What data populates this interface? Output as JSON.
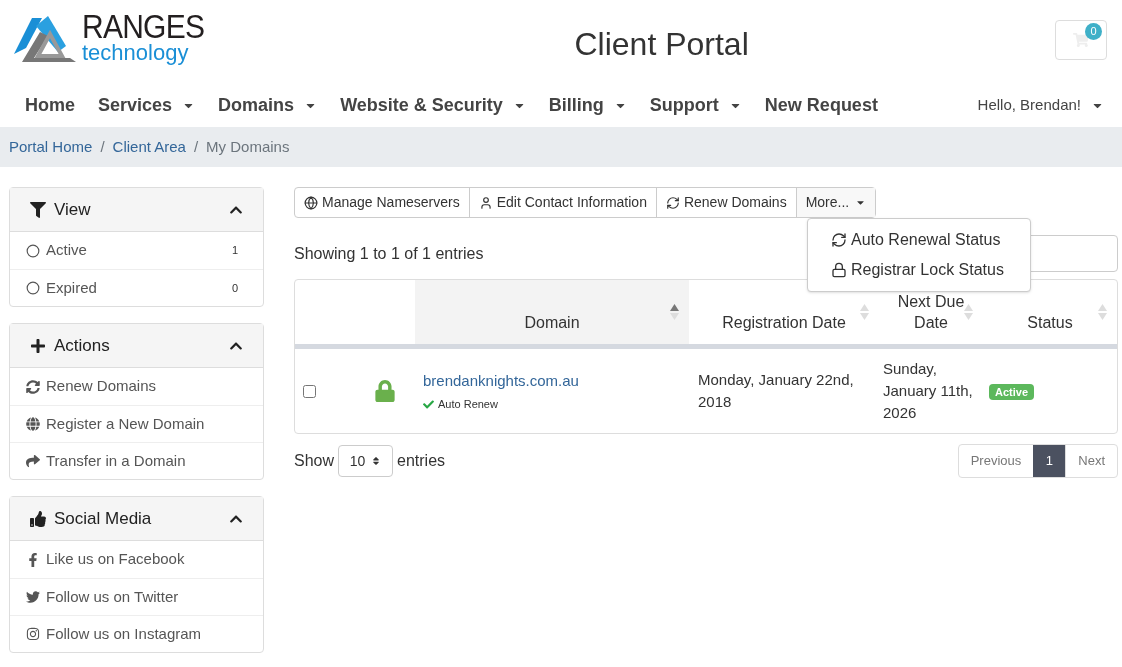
{
  "header": {
    "logo": {
      "line_1": "RANGES",
      "line_2": "technology"
    },
    "title": "Client Portal",
    "cart": {
      "count": "0"
    }
  },
  "nav": {
    "items": [
      {
        "label": "Home",
        "dropdown": false
      },
      {
        "label": "Services",
        "dropdown": true
      },
      {
        "label": "Domains",
        "dropdown": true
      },
      {
        "label": "Website & Security",
        "dropdown": true
      },
      {
        "label": "Billing",
        "dropdown": true
      },
      {
        "label": "Support",
        "dropdown": true
      },
      {
        "label": "New Request",
        "dropdown": false
      }
    ],
    "user": "Hello, Brendan!"
  },
  "breadcrumb": {
    "separator": "/",
    "items": [
      {
        "label": "Portal Home",
        "link": true
      },
      {
        "label": "Client Area",
        "link": true
      },
      {
        "label": "My Domains",
        "link": false
      }
    ]
  },
  "sidebar": [
    {
      "title": "View",
      "expanded": true,
      "items": [
        {
          "label": "Active",
          "count": "1"
        },
        {
          "label": "Expired",
          "count": "0"
        }
      ]
    },
    {
      "title": "Actions",
      "expanded": true,
      "items": [
        {
          "label": "Renew Domains"
        },
        {
          "label": "Register a New Domain"
        },
        {
          "label": "Transfer in a Domain"
        }
      ]
    },
    {
      "title": "Social Media",
      "expanded": true,
      "items": [
        {
          "label": "Like us on Facebook"
        },
        {
          "label": "Follow us on Twitter"
        },
        {
          "label": "Follow us on Instagram"
        }
      ]
    }
  ],
  "toolbar": {
    "buttons": [
      "Manage Nameservers",
      "Edit Contact Information",
      "Renew Domains"
    ],
    "more": {
      "label": "More...",
      "expanded": true,
      "items": [
        "Auto Renewal Status",
        "Registrar Lock Status"
      ]
    }
  },
  "info": "Showing 1 to 1 of 1 entries",
  "table": {
    "columns": [
      {
        "label": "Domain",
        "sorted": true
      },
      {
        "label": "Registration Date",
        "sorted": false
      },
      {
        "label": "Next Due Date",
        "sorted": false
      },
      {
        "label": "Status",
        "sorted": false
      }
    ],
    "rows": [
      {
        "checked": false,
        "locked": true,
        "domain": "brendanknights.com.au",
        "auto_renew": true,
        "auto_renew_label": "Auto Renew",
        "registration_date": "Monday, January 22nd, 2018",
        "next_due_date": "Sunday, January 11th, 2026",
        "status": "Active",
        "color": "#5cb85c"
      }
    ]
  },
  "length": {
    "before": "Show",
    "value": "10",
    "after": "entries"
  },
  "pagination": {
    "previous": "Previous",
    "pages": [
      {
        "label": "1",
        "selected": true
      }
    ],
    "next": "Next"
  }
}
